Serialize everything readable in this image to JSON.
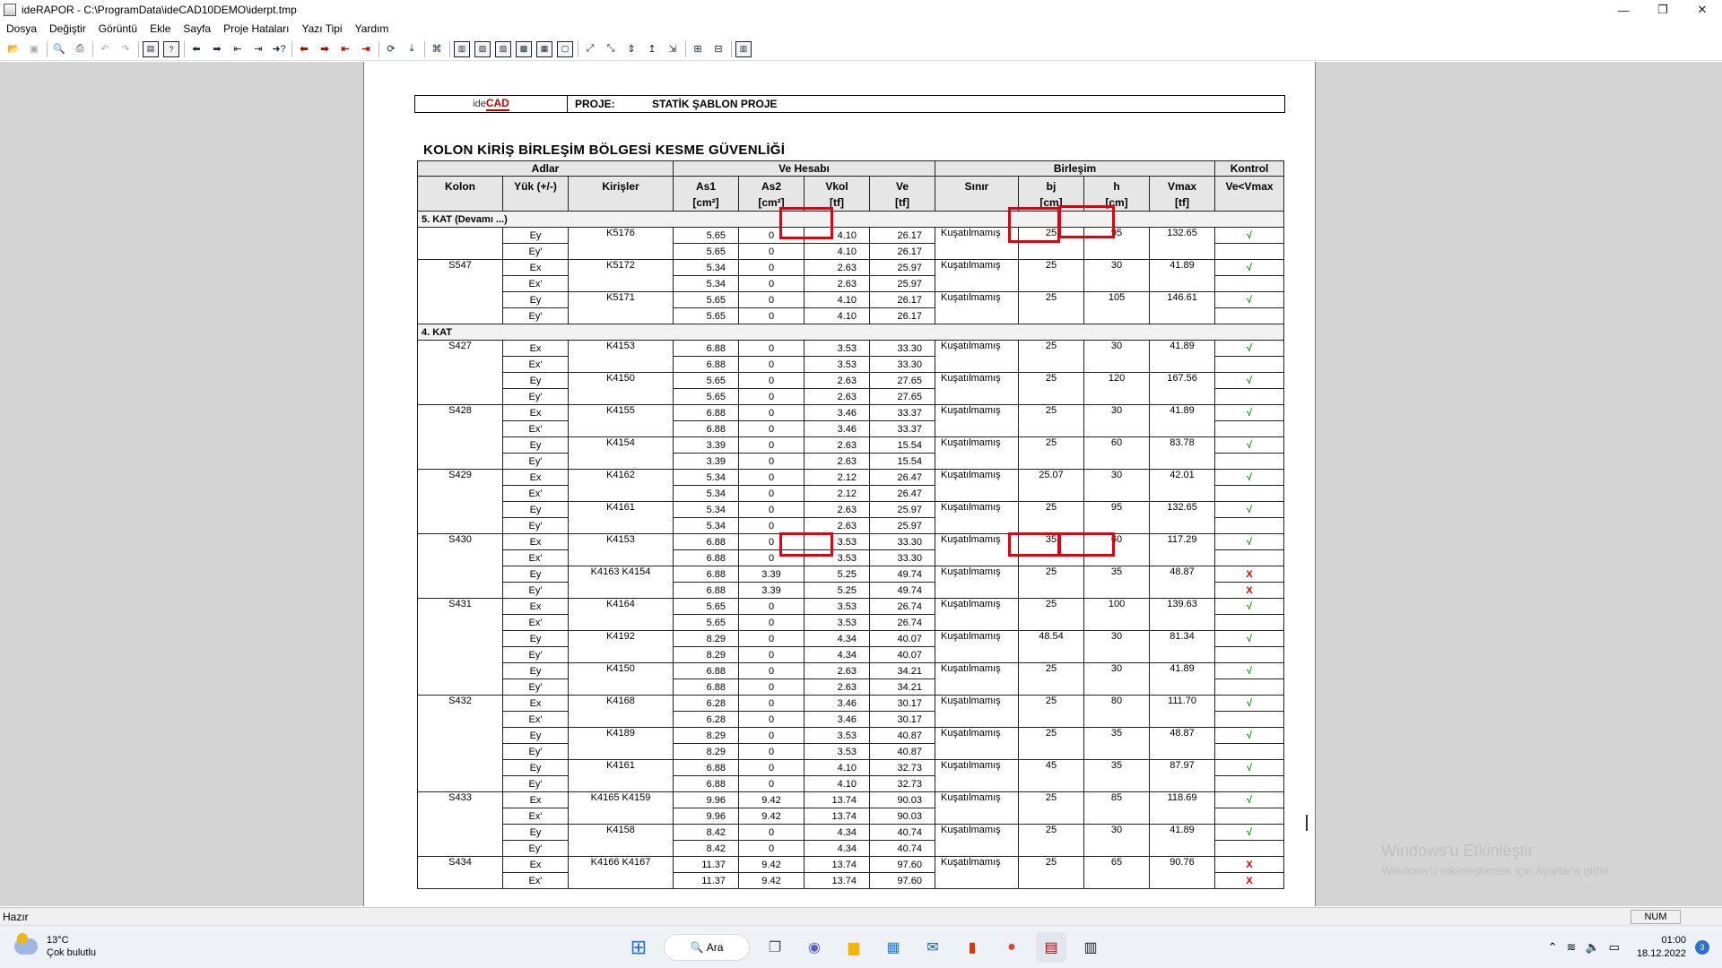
{
  "window": {
    "title": "ideRAPOR - C:\\ProgramData\\ideCAD10DEMO\\iderpt.tmp",
    "minimize": "—",
    "maximize": "❐",
    "close": "✕"
  },
  "menu": [
    "Dosya",
    "Değiştir",
    "Görüntü",
    "Ekle",
    "Sayfa",
    "Proje Hataları",
    "Yazı Tipi",
    "Yardım"
  ],
  "report": {
    "logo_ide": "ide",
    "logo_cad": "CAD",
    "project_label": "PROJE:",
    "project_name": "STATİK ŞABLON PROJE",
    "title": "KOLON KİRİŞ BİRLEŞİM BÖLGESİ KESME GÜVENLİĞİ",
    "group_headers": {
      "adlar": "Adlar",
      "ve_hesabi": "Ve Hesabı",
      "birlesim": "Birleşim",
      "kontrol": "Kontrol"
    },
    "columns": {
      "kolon": "Kolon",
      "yuk": "Yük (+/-)",
      "kirisler": "Kirişler",
      "as1": "As1",
      "as1_unit": "[cm²]",
      "as2": "As2",
      "as2_unit": "[cm²]",
      "vkol": "Vkol",
      "vkol_unit": "[tf]",
      "ve": "Ve",
      "ve_unit": "[tf]",
      "sinir": "Sınır",
      "bj": "bj",
      "bj_unit": "[cm]",
      "h": "h",
      "h_unit": "[cm]",
      "vmax": "Vmax",
      "vmax_unit": "[tf]",
      "kontrol": "Ve<Vmax"
    },
    "ok_mark": "√",
    "bad_mark": "X",
    "sections": [
      {
        "label": "5. KAT   (Devamı ...)",
        "columns": [
          {
            "kolon": "",
            "groups": [
              {
                "kirisler": "K5176",
                "sinir": "Kuşatılmamış",
                "bj": "25",
                "h": "95",
                "vmax": "132.65",
                "rows": [
                  {
                    "yuk": "Ey",
                    "as1": "5.65",
                    "as2": "0",
                    "vkol": "4.10",
                    "ve": "26.17",
                    "ok": true
                  },
                  {
                    "yuk": "Ey'",
                    "as1": "5.65",
                    "as2": "0",
                    "vkol": "4.10",
                    "ve": "26.17",
                    "ok": null
                  }
                ]
              }
            ]
          },
          {
            "kolon": "S547",
            "groups": [
              {
                "kirisler": "K5172",
                "sinir": "Kuşatılmamış",
                "bj": "25",
                "h": "30",
                "vmax": "41.89",
                "rows": [
                  {
                    "yuk": "Ex",
                    "as1": "5.34",
                    "as2": "0",
                    "vkol": "2.63",
                    "ve": "25.97",
                    "ok": true
                  },
                  {
                    "yuk": "Ex'",
                    "as1": "5.34",
                    "as2": "0",
                    "vkol": "2.63",
                    "ve": "25.97",
                    "ok": null
                  }
                ]
              },
              {
                "kirisler": "K5171",
                "sinir": "Kuşatılmamış",
                "bj": "25",
                "h": "105",
                "vmax": "146.61",
                "rows": [
                  {
                    "yuk": "Ey",
                    "as1": "5.65",
                    "as2": "0",
                    "vkol": "4.10",
                    "ve": "26.17",
                    "ok": true
                  },
                  {
                    "yuk": "Ey'",
                    "as1": "5.65",
                    "as2": "0",
                    "vkol": "4.10",
                    "ve": "26.17",
                    "ok": null
                  }
                ]
              }
            ]
          }
        ]
      },
      {
        "label": "4. KAT",
        "columns": [
          {
            "kolon": "S427",
            "groups": [
              {
                "kirisler": "K4153",
                "sinir": "Kuşatılmamış",
                "bj": "25",
                "h": "30",
                "vmax": "41.89",
                "rows": [
                  {
                    "yuk": "Ex",
                    "as1": "6.88",
                    "as2": "0",
                    "vkol": "3.53",
                    "ve": "33.30",
                    "ok": true
                  },
                  {
                    "yuk": "Ex'",
                    "as1": "6.88",
                    "as2": "0",
                    "vkol": "3.53",
                    "ve": "33.30",
                    "ok": null
                  }
                ]
              },
              {
                "kirisler": "K4150",
                "sinir": "Kuşatılmamış",
                "bj": "25",
                "h": "120",
                "vmax": "167.56",
                "rows": [
                  {
                    "yuk": "Ey",
                    "as1": "5.65",
                    "as2": "0",
                    "vkol": "2.63",
                    "ve": "27.65",
                    "ok": true
                  },
                  {
                    "yuk": "Ey'",
                    "as1": "5.65",
                    "as2": "0",
                    "vkol": "2.63",
                    "ve": "27.65",
                    "ok": null
                  }
                ]
              }
            ]
          },
          {
            "kolon": "S428",
            "groups": [
              {
                "kirisler": "K4155",
                "sinir": "Kuşatılmamış",
                "bj": "25",
                "h": "30",
                "vmax": "41.89",
                "rows": [
                  {
                    "yuk": "Ex",
                    "as1": "6.88",
                    "as2": "0",
                    "vkol": "3.46",
                    "ve": "33.37",
                    "ok": true
                  },
                  {
                    "yuk": "Ex'",
                    "as1": "6.88",
                    "as2": "0",
                    "vkol": "3.46",
                    "ve": "33.37",
                    "ok": null
                  }
                ]
              },
              {
                "kirisler": "K4154",
                "sinir": "Kuşatılmamış",
                "bj": "25",
                "h": "60",
                "vmax": "83.78",
                "rows": [
                  {
                    "yuk": "Ey",
                    "as1": "3.39",
                    "as2": "0",
                    "vkol": "2.63",
                    "ve": "15.54",
                    "ok": true
                  },
                  {
                    "yuk": "Ey'",
                    "as1": "3.39",
                    "as2": "0",
                    "vkol": "2.63",
                    "ve": "15.54",
                    "ok": null
                  }
                ]
              }
            ]
          },
          {
            "kolon": "S429",
            "groups": [
              {
                "kirisler": "K4162",
                "sinir": "Kuşatılmamış",
                "bj": "25.07",
                "h": "30",
                "vmax": "42.01",
                "rows": [
                  {
                    "yuk": "Ex",
                    "as1": "5.34",
                    "as2": "0",
                    "vkol": "2.12",
                    "ve": "26.47",
                    "ok": true
                  },
                  {
                    "yuk": "Ex'",
                    "as1": "5.34",
                    "as2": "0",
                    "vkol": "2.12",
                    "ve": "26.47",
                    "ok": null
                  }
                ]
              },
              {
                "kirisler": "K4161",
                "sinir": "Kuşatılmamış",
                "bj": "25",
                "h": "95",
                "vmax": "132.65",
                "rows": [
                  {
                    "yuk": "Ey",
                    "as1": "5.34",
                    "as2": "0",
                    "vkol": "2.63",
                    "ve": "25.97",
                    "ok": true
                  },
                  {
                    "yuk": "Ey'",
                    "as1": "5.34",
                    "as2": "0",
                    "vkol": "2.63",
                    "ve": "25.97",
                    "ok": null
                  }
                ]
              }
            ]
          },
          {
            "kolon": "S430",
            "groups": [
              {
                "kirisler": "K4153",
                "sinir": "Kuşatılmamış",
                "bj": "35",
                "h": "60",
                "vmax": "117.29",
                "rows": [
                  {
                    "yuk": "Ex",
                    "as1": "6.88",
                    "as2": "0",
                    "vkol": "3.53",
                    "ve": "33.30",
                    "ok": true
                  },
                  {
                    "yuk": "Ex'",
                    "as1": "6.88",
                    "as2": "0",
                    "vkol": "3.53",
                    "ve": "33.30",
                    "ok": null
                  }
                ]
              },
              {
                "kirisler": "K4163 K4154",
                "sinir": "Kuşatılmamış",
                "bj": "25",
                "h": "35",
                "vmax": "48.87",
                "rows": [
                  {
                    "yuk": "Ey",
                    "as1": "6.88",
                    "as2": "3.39",
                    "vkol": "5.25",
                    "ve": "49.74",
                    "ok": false
                  },
                  {
                    "yuk": "Ey'",
                    "as1": "6.88",
                    "as2": "3.39",
                    "vkol": "5.25",
                    "ve": "49.74",
                    "ok": false
                  }
                ]
              }
            ]
          },
          {
            "kolon": "S431",
            "groups": [
              {
                "kirisler": "K4164",
                "sinir": "Kuşatılmamış",
                "bj": "25",
                "h": "100",
                "vmax": "139.63",
                "rows": [
                  {
                    "yuk": "Ex",
                    "as1": "5.65",
                    "as2": "0",
                    "vkol": "3.53",
                    "ve": "26.74",
                    "ok": true
                  },
                  {
                    "yuk": "Ex'",
                    "as1": "5.65",
                    "as2": "0",
                    "vkol": "3.53",
                    "ve": "26.74",
                    "ok": null
                  }
                ]
              },
              {
                "kirisler": "K4192",
                "sinir": "Kuşatılmamış",
                "bj": "48.54",
                "h": "30",
                "vmax": "81.34",
                "rows": [
                  {
                    "yuk": "Ey",
                    "as1": "8.29",
                    "as2": "0",
                    "vkol": "4.34",
                    "ve": "40.07",
                    "ok": true
                  },
                  {
                    "yuk": "Ey'",
                    "as1": "8.29",
                    "as2": "0",
                    "vkol": "4.34",
                    "ve": "40.07",
                    "ok": null
                  }
                ]
              },
              {
                "kirisler": "K4150",
                "sinir": "Kuşatılmamış",
                "bj": "25",
                "h": "30",
                "vmax": "41.89",
                "rows": [
                  {
                    "yuk": "Ey",
                    "as1": "6.88",
                    "as2": "0",
                    "vkol": "2.63",
                    "ve": "34.21",
                    "ok": true
                  },
                  {
                    "yuk": "Ey'",
                    "as1": "6.88",
                    "as2": "0",
                    "vkol": "2.63",
                    "ve": "34.21",
                    "ok": null
                  }
                ]
              }
            ]
          },
          {
            "kolon": "S432",
            "groups": [
              {
                "kirisler": "K4168",
                "sinir": "Kuşatılmamış",
                "bj": "25",
                "h": "80",
                "vmax": "111.70",
                "rows": [
                  {
                    "yuk": "Ex",
                    "as1": "6.28",
                    "as2": "0",
                    "vkol": "3.46",
                    "ve": "30.17",
                    "ok": true
                  },
                  {
                    "yuk": "Ex'",
                    "as1": "6.28",
                    "as2": "0",
                    "vkol": "3.46",
                    "ve": "30.17",
                    "ok": null
                  }
                ]
              },
              {
                "kirisler": "K4189",
                "sinir": "Kuşatılmamış",
                "bj": "25",
                "h": "35",
                "vmax": "48.87",
                "rows": [
                  {
                    "yuk": "Ey",
                    "as1": "8.29",
                    "as2": "0",
                    "vkol": "3.53",
                    "ve": "40.87",
                    "ok": true
                  },
                  {
                    "yuk": "Ey'",
                    "as1": "8.29",
                    "as2": "0",
                    "vkol": "3.53",
                    "ve": "40.87",
                    "ok": null
                  }
                ]
              },
              {
                "kirisler": "K4161",
                "sinir": "Kuşatılmamış",
                "bj": "45",
                "h": "35",
                "vmax": "87.97",
                "rows": [
                  {
                    "yuk": "Ey",
                    "as1": "6.88",
                    "as2": "0",
                    "vkol": "4.10",
                    "ve": "32.73",
                    "ok": true
                  },
                  {
                    "yuk": "Ey'",
                    "as1": "6.88",
                    "as2": "0",
                    "vkol": "4.10",
                    "ve": "32.73",
                    "ok": null
                  }
                ]
              }
            ]
          },
          {
            "kolon": "S433",
            "groups": [
              {
                "kirisler": "K4165 K4159",
                "sinir": "Kuşatılmamış",
                "bj": "25",
                "h": "85",
                "vmax": "118.69",
                "rows": [
                  {
                    "yuk": "Ex",
                    "as1": "9.96",
                    "as2": "9.42",
                    "vkol": "13.74",
                    "ve": "90.03",
                    "ok": true
                  },
                  {
                    "yuk": "Ex'",
                    "as1": "9.96",
                    "as2": "9.42",
                    "vkol": "13.74",
                    "ve": "90.03",
                    "ok": null
                  }
                ]
              },
              {
                "kirisler": "K4158",
                "sinir": "Kuşatılmamış",
                "bj": "25",
                "h": "30",
                "vmax": "41.89",
                "rows": [
                  {
                    "yuk": "Ey",
                    "as1": "8.42",
                    "as2": "0",
                    "vkol": "4.34",
                    "ve": "40.74",
                    "ok": true
                  },
                  {
                    "yuk": "Ey'",
                    "as1": "8.42",
                    "as2": "0",
                    "vkol": "4.34",
                    "ve": "40.74",
                    "ok": null
                  }
                ]
              }
            ]
          },
          {
            "kolon": "S434",
            "groups": [
              {
                "kirisler": "K4166 K4167",
                "sinir": "Kuşatılmamış",
                "bj": "25",
                "h": "65",
                "vmax": "90.76",
                "rows": [
                  {
                    "yuk": "Ex",
                    "as1": "11.37",
                    "as2": "9.42",
                    "vkol": "13.74",
                    "ve": "97.60",
                    "ok": false
                  },
                  {
                    "yuk": "Ex'",
                    "as1": "11.37",
                    "as2": "9.42",
                    "vkol": "13.74",
                    "ve": "97.60",
                    "ok": false
                  }
                ]
              }
            ]
          }
        ]
      }
    ]
  },
  "watermark": {
    "line1": "Windows'u Etkinleştir",
    "line2": "Windows'u etkinleştirmek için Ayarlar'a gidin."
  },
  "statusbar": {
    "text": "Hazır",
    "num": "NUM"
  },
  "taskbar": {
    "weather_temp": "13°C",
    "weather_desc": "Çok bulutlu",
    "search_label": "Ara",
    "time": "01:00",
    "date": "18.12.2022",
    "notifications": "3",
    "icons": [
      "windows-start-icon",
      "task-view-icon",
      "teams-chat-icon",
      "file-explorer-icon",
      "microsoft-store-icon",
      "mail-icon",
      "office-icon",
      "chrome-icon",
      "iderapor-app-icon",
      "idecad-app-icon"
    ]
  },
  "colors": {
    "ok": "#1a8a1a",
    "bad": "#d00000",
    "highlight": "#e0000f"
  }
}
